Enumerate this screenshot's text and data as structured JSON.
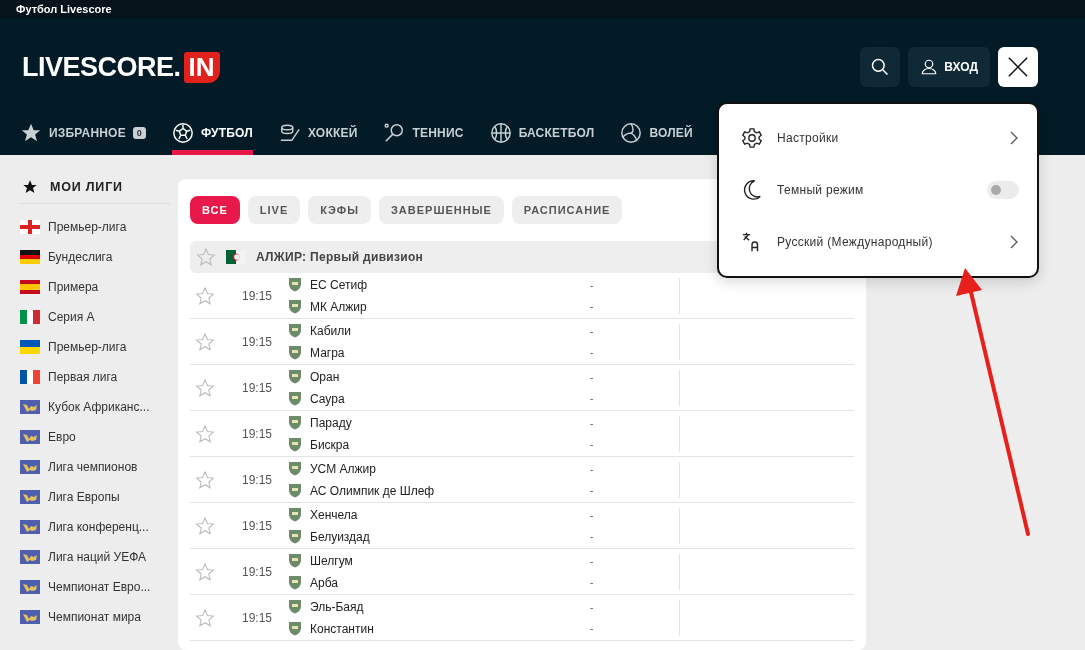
{
  "page_title": "Футбол Livescore",
  "header": {
    "logo_word": "LIVESCORE.",
    "logo_badge": "IN",
    "login_label": "ВХОД"
  },
  "nav": [
    {
      "label": "ИЗБРАННОЕ",
      "kind": "favorites",
      "count": "0",
      "selected": false
    },
    {
      "label": "ФУТБОЛ",
      "kind": "football",
      "selected": true
    },
    {
      "label": "ХОККЕЙ",
      "kind": "hockey",
      "selected": false
    },
    {
      "label": "ТЕННИС",
      "kind": "tennis",
      "selected": false
    },
    {
      "label": "БАСКЕТБОЛ",
      "kind": "basketball",
      "selected": false
    },
    {
      "label": "ВОЛЕЙ",
      "kind": "volleyball",
      "selected": false
    }
  ],
  "sidebar": {
    "title": "МОИ ЛИГИ",
    "items": [
      {
        "label": "Премьер-лига",
        "kind": "england"
      },
      {
        "label": "Бундеслига",
        "kind": "germany"
      },
      {
        "label": "Примера",
        "kind": "spain"
      },
      {
        "label": "Серия А",
        "kind": "italy"
      },
      {
        "label": "Премьер-лига",
        "kind": "ukraine"
      },
      {
        "label": "Первая лига",
        "kind": "france"
      },
      {
        "label": "Кубок Африканс...",
        "kind": "world"
      },
      {
        "label": "Евро",
        "kind": "world"
      },
      {
        "label": "Лига чемпионов",
        "kind": "world"
      },
      {
        "label": "Лига Европы",
        "kind": "world"
      },
      {
        "label": "Лига конференц...",
        "kind": "world"
      },
      {
        "label": "Лига наций УЕФА",
        "kind": "world"
      },
      {
        "label": "Чемпионат Евро...",
        "kind": "world"
      },
      {
        "label": "Чемпионат мира",
        "kind": "world"
      }
    ]
  },
  "filters": [
    {
      "label": "ВСЕ",
      "selected": true
    },
    {
      "label": "LIVE",
      "selected": false
    },
    {
      "label": "КЭФЫ",
      "selected": false
    },
    {
      "label": "ЗАВЕРШЕННЫЕ",
      "selected": false
    },
    {
      "label": "РАСПИСАНИЕ",
      "selected": false
    }
  ],
  "league": {
    "name": "АЛЖИР: Первый дивизион",
    "kind": "algeria"
  },
  "matches": [
    {
      "time": "19:15",
      "home": "ЕС Сетиф",
      "away": "МК Алжир",
      "home_score": "-",
      "away_score": "-"
    },
    {
      "time": "19:15",
      "home": "Кабили",
      "away": "Магра",
      "home_score": "-",
      "away_score": "-"
    },
    {
      "time": "19:15",
      "home": "Оран",
      "away": "Саура",
      "home_score": "-",
      "away_score": "-"
    },
    {
      "time": "19:15",
      "home": "Параду",
      "away": "Бискра",
      "home_score": "-",
      "away_score": "-"
    },
    {
      "time": "19:15",
      "home": "УСМ Алжир",
      "away": "АС Олимпик де Шлеф",
      "home_score": "-",
      "away_score": "-"
    },
    {
      "time": "19:15",
      "home": "Хенчела",
      "away": "Белуиздад",
      "home_score": "-",
      "away_score": "-"
    },
    {
      "time": "19:15",
      "home": "Шелгум",
      "away": "Арба",
      "home_score": "-",
      "away_score": "-"
    },
    {
      "time": "19:15",
      "home": "Эль-Баяд",
      "away": "Константин",
      "home_score": "-",
      "away_score": "-"
    }
  ],
  "menu": {
    "items": [
      {
        "kind": "link",
        "label": "Настройки"
      },
      {
        "kind": "toggle",
        "label": "Темный режим",
        "on": false
      },
      {
        "kind": "link",
        "label": "Русский (Международный)"
      }
    ]
  }
}
